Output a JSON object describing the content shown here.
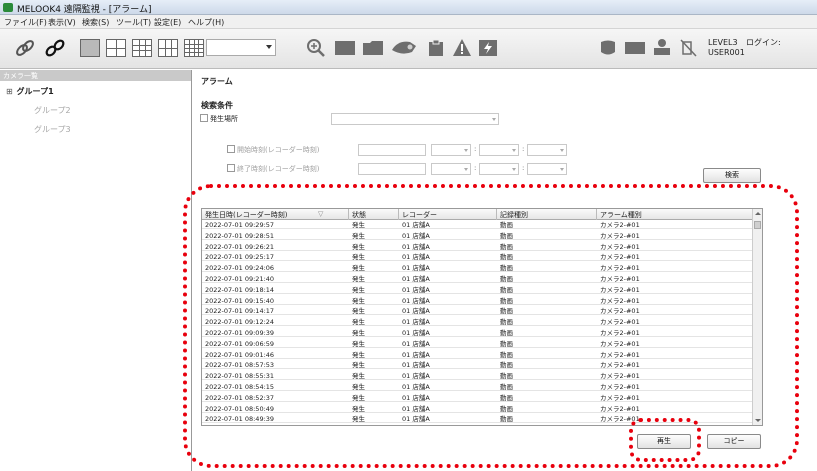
{
  "window": {
    "title": "MELOOK4 遠隔監視 - [アラーム]"
  },
  "menu": [
    "ファイル(F)",
    "表示(V)",
    "検索(S)",
    "ツール(T)",
    "設定(E)",
    "ヘルプ(H)"
  ],
  "toolbar": {
    "dropdown_value": "",
    "level": "LEVEL3",
    "user": "USER001",
    "login_label": "ログイン:"
  },
  "sidebar": {
    "header": "カメラ一覧",
    "groups": [
      "グループ1",
      "グループ2",
      "グループ3"
    ]
  },
  "alarm": {
    "title": "アラーム",
    "search_conditions": "検索条件",
    "location_label": "発生場所",
    "start_label": "開始時刻(レコーダー時刻)",
    "end_label": "終了時刻(レコーダー時刻)",
    "search_button": "検索",
    "play_button": "再生",
    "copy_button": "コピー"
  },
  "table": {
    "columns": [
      "発生日時(レコーダー時刻)",
      "状態",
      "レコーダー",
      "記録種別",
      "アラーム種別"
    ],
    "rows": [
      [
        "2022-07-01 09:29:57",
        "発生",
        "01 店舗A",
        "動画",
        "カメラ2-#01"
      ],
      [
        "2022-07-01 09:28:51",
        "発生",
        "01 店舗A",
        "動画",
        "カメラ2-#01"
      ],
      [
        "2022-07-01 09:26:21",
        "発生",
        "01 店舗A",
        "動画",
        "カメラ2-#01"
      ],
      [
        "2022-07-01 09:25:17",
        "発生",
        "01 店舗A",
        "動画",
        "カメラ2-#01"
      ],
      [
        "2022-07-01 09:24:06",
        "発生",
        "01 店舗A",
        "動画",
        "カメラ2-#01"
      ],
      [
        "2022-07-01 09:21:40",
        "発生",
        "01 店舗A",
        "動画",
        "カメラ2-#01"
      ],
      [
        "2022-07-01 09:18:14",
        "発生",
        "01 店舗A",
        "動画",
        "カメラ2-#01"
      ],
      [
        "2022-07-01 09:15:40",
        "発生",
        "01 店舗A",
        "動画",
        "カメラ2-#01"
      ],
      [
        "2022-07-01 09:14:17",
        "発生",
        "01 店舗A",
        "動画",
        "カメラ2-#01"
      ],
      [
        "2022-07-01 09:12:24",
        "発生",
        "01 店舗A",
        "動画",
        "カメラ2-#01"
      ],
      [
        "2022-07-01 09:09:39",
        "発生",
        "01 店舗A",
        "動画",
        "カメラ2-#01"
      ],
      [
        "2022-07-01 09:06:59",
        "発生",
        "01 店舗A",
        "動画",
        "カメラ2-#01"
      ],
      [
        "2022-07-01 09:01:46",
        "発生",
        "01 店舗A",
        "動画",
        "カメラ2-#01"
      ],
      [
        "2022-07-01 08:57:53",
        "発生",
        "01 店舗A",
        "動画",
        "カメラ2-#01"
      ],
      [
        "2022-07-01 08:55:31",
        "発生",
        "01 店舗A",
        "動画",
        "カメラ2-#01"
      ],
      [
        "2022-07-01 08:54:15",
        "発生",
        "01 店舗A",
        "動画",
        "カメラ2-#01"
      ],
      [
        "2022-07-01 08:52:37",
        "発生",
        "01 店舗A",
        "動画",
        "カメラ2-#01"
      ],
      [
        "2022-07-01 08:50:49",
        "発生",
        "01 店舗A",
        "動画",
        "カメラ2-#01"
      ],
      [
        "2022-07-01 08:49:39",
        "発生",
        "01 店舗A",
        "動画",
        "カメラ2-#01"
      ]
    ]
  },
  "colors": {
    "annotation": "#e8000d",
    "icon_gray": "#6e6e6e"
  }
}
